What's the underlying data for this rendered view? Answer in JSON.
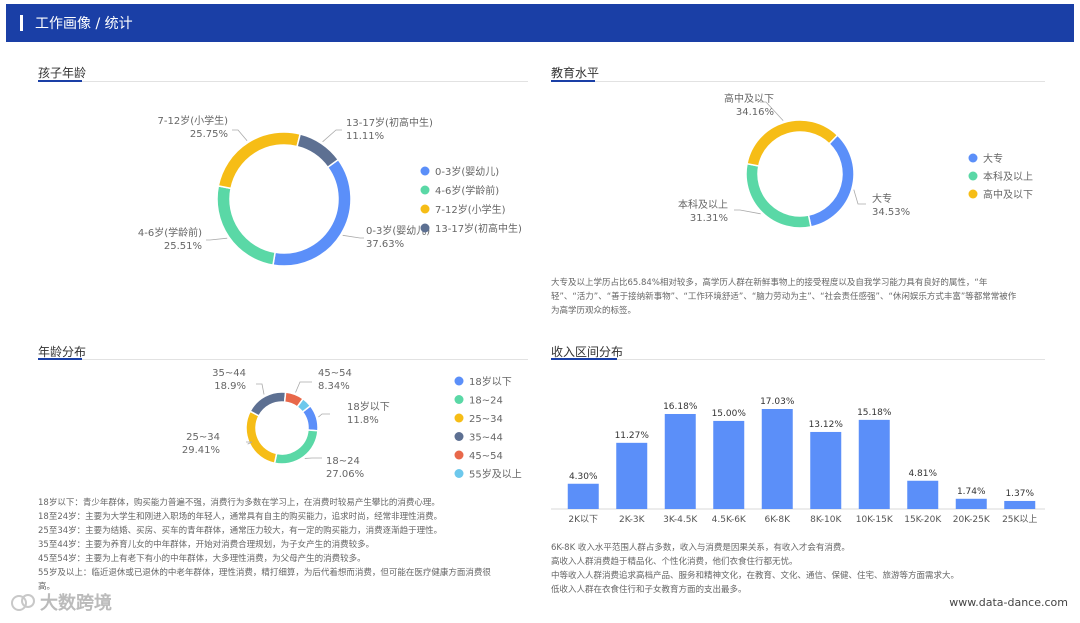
{
  "header": {
    "title": "工作画像 / 统计"
  },
  "sections": {
    "child_age": "孩子年龄",
    "education": "教育水平",
    "age_dist": "年龄分布",
    "income": "收入区间分布"
  },
  "notes": {
    "education": [
      "大专及以上学历占比65.84%相对较多，高学历人群在新鲜事物上的接受程度以及自我学习能力具有良好的属性，“年",
      "轻”、“活力”、“善于接纳新事物”、“工作环境舒适”、“脑力劳动为主”、“社会责任感强”、“休闲娱乐方式丰富”等都常常被作",
      "为高学历观众的标签。"
    ],
    "age": [
      "18岁以下：青少年群体，购买能力普遍不强，消费行为多数在学习上，在消费时较易产生攀比的消费心理。",
      "18至24岁：主要为大学生和刚进入职场的年轻人，通常具有自主的购买能力，追求时尚，经常非理性消费。",
      "25至34岁：主要为结婚、买房、买车的青年群体，通常压力较大，有一定的购买能力，消费逐渐趋于理性。",
      "35至44岁：主要为养育儿女的中年群体，开始对消费合理规划，为子女产生的消费较多。",
      "45至54岁：主要为上有老下有小的中年群体，大多理性消费，为父母产生的消费较多。",
      "55岁及以上：临近退休或已退休的中老年群体，理性消费，精打细算，为后代着想而消费，但可能在医疗健康方面消费很",
      "高。"
    ],
    "income": [
      "6K-8K 收入水平范围人群占多数，收入与消费是因果关系，有收入才会有消费。",
      "高收入人群消费趋于精品化、个性化消费，他们衣食住行都无忧。",
      "中等收入人群消费追求高档产品、服务和精神文化，在教育、文化、通信、保健、住宅、旅游等方面需求大。",
      "低收入人群在衣食住行和子女教育方面的支出最多。"
    ]
  },
  "footer": {
    "url": "www.data-dance.com",
    "logo": "大数跨境"
  },
  "colors": {
    "blue": "#5b8ff9",
    "green": "#5ad8a6",
    "yellow": "#f6bd16",
    "navy": "#5d7092",
    "red": "#e8684a",
    "cyan": "#6dc8ec",
    "header": "#1a3fa6"
  },
  "chart_data": [
    {
      "type": "pie",
      "title": "孩子年龄",
      "categories": [
        "0-3岁(婴幼儿)",
        "4-6岁(学龄前)",
        "7-12岁(小学生)",
        "13-17岁(初高中生)"
      ],
      "values": [
        37.63,
        25.51,
        25.75,
        11.11
      ],
      "labels": [
        "37.63%",
        "25.51%",
        "25.75%",
        "11.11%"
      ],
      "legend": "right"
    },
    {
      "type": "pie",
      "title": "教育水平",
      "categories": [
        "大专",
        "本科及以上",
        "高中及以下"
      ],
      "values": [
        34.53,
        31.31,
        34.16
      ],
      "labels": [
        "34.53%",
        "31.31%",
        "34.16%"
      ],
      "legend": "right"
    },
    {
      "type": "pie",
      "title": "年龄分布",
      "categories": [
        "18岁以下",
        "18~24",
        "25~34",
        "35~44",
        "45~54",
        "55岁及以上"
      ],
      "values": [
        11.8,
        27.06,
        29.41,
        18.9,
        8.34,
        4.49
      ],
      "labels": [
        "11.8%",
        "27.06%",
        "29.41%",
        "18.9%",
        "8.34%",
        ""
      ],
      "legend": "right"
    },
    {
      "type": "bar",
      "title": "收入区间分布",
      "categories": [
        "2K以下",
        "2K-3K",
        "3K-4.5K",
        "4.5K-6K",
        "6K-8K",
        "8K-10K",
        "10K-15K",
        "15K-20K",
        "20K-25K",
        "25K以上"
      ],
      "values": [
        4.3,
        11.27,
        16.18,
        15.0,
        17.03,
        13.12,
        15.18,
        4.81,
        1.74,
        1.37
      ],
      "labels": [
        "4.30%",
        "11.27%",
        "16.18%",
        "15.00%",
        "17.03%",
        "13.12%",
        "15.18%",
        "4.81%",
        "1.74%",
        "1.37%"
      ]
    }
  ]
}
